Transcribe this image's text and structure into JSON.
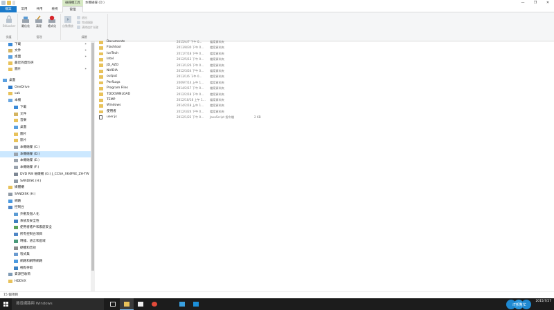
{
  "window": {
    "title": "本機磁碟 (D:)",
    "context_tab_group": "磁碟機工具",
    "controls": [
      "—",
      "❐",
      "✕"
    ]
  },
  "ribbon": {
    "tabs": [
      "檔案",
      "常用",
      "共用",
      "檢視",
      "管理"
    ],
    "groups": [
      {
        "label": "保護",
        "buttons": [
          "BitLocker"
        ]
      },
      {
        "label": "管理",
        "buttons": [
          "最佳化",
          "清理",
          "格式化"
        ]
      },
      {
        "label": "媒體",
        "buttons": [
          "自動播放"
        ],
        "small_cmds": [
          "退出",
          "完成燒錄",
          "清除這片光碟"
        ]
      }
    ]
  },
  "nav": {
    "quick_access": [
      {
        "label": "下載",
        "icon": "download-icon",
        "pinned": true
      },
      {
        "label": "文件",
        "icon": "documents-icon",
        "pinned": true
      },
      {
        "label": "桌面",
        "icon": "desktop-icon",
        "pinned": true
      },
      {
        "label": "最近的資料夾",
        "icon": "recent-folders-icon",
        "pinned": false
      },
      {
        "label": "圖片",
        "icon": "pictures-icon",
        "pinned": true
      }
    ],
    "tree": [
      {
        "label": "桌面",
        "icon": "desktop-icon",
        "level": 0
      },
      {
        "label": "OneDrive",
        "icon": "cloud-icon",
        "level": 1
      },
      {
        "label": "cak",
        "icon": "user-icon",
        "level": 1
      },
      {
        "label": "本機",
        "icon": "computer-icon",
        "level": 1
      },
      {
        "label": "下載",
        "icon": "download-icon",
        "level": 2
      },
      {
        "label": "文件",
        "icon": "documents-icon",
        "level": 2
      },
      {
        "label": "音樂",
        "icon": "music-icon",
        "level": 2
      },
      {
        "label": "桌面",
        "icon": "desktop-icon",
        "level": 2
      },
      {
        "label": "圖片",
        "icon": "pictures-icon",
        "level": 2
      },
      {
        "label": "影片",
        "icon": "videos-icon",
        "level": 2
      },
      {
        "label": "本機磁碟 (C:)",
        "icon": "drive-icon",
        "level": 2
      },
      {
        "label": "本機磁碟 (D:)",
        "icon": "drive-icon",
        "level": 2,
        "selected": true
      },
      {
        "label": "本機磁碟 (E:)",
        "icon": "drive-icon",
        "level": 2
      },
      {
        "label": "本機磁碟 (F:)",
        "icon": "drive-icon",
        "level": 2
      },
      {
        "label": "DVD RW 磁碟機 (G:) J_CCSA_X64FRE_ZH-TW",
        "icon": "dvd-icon",
        "level": 2
      },
      {
        "label": "SANDISK (H:)",
        "icon": "usb-drive-icon",
        "level": 2
      },
      {
        "label": "媒體櫃",
        "icon": "library-icon",
        "level": 1
      },
      {
        "label": "SANDISK (H:)",
        "icon": "usb-drive-icon",
        "level": 1
      },
      {
        "label": "網路",
        "icon": "network-icon",
        "level": 1
      },
      {
        "label": "控制台",
        "icon": "control-panel-icon",
        "level": 1
      },
      {
        "label": "外觀及個人化",
        "icon": "appearance-icon",
        "level": 2
      },
      {
        "label": "系統及安全性",
        "icon": "security-icon",
        "level": 2
      },
      {
        "label": "使用者帳戶和家庭安全",
        "icon": "users-icon",
        "level": 2
      },
      {
        "label": "所有控制台項目",
        "icon": "control-panel-icon",
        "level": 2
      },
      {
        "label": "時鐘、語言和區域",
        "icon": "clock-icon",
        "level": 2
      },
      {
        "label": "硬體和音效",
        "icon": "hardware-icon",
        "level": 2
      },
      {
        "label": "程式集",
        "icon": "programs-icon",
        "level": 2
      },
      {
        "label": "網路和網際網路",
        "icon": "network-icon",
        "level": 2
      },
      {
        "label": "輕鬆存取",
        "icon": "ease-of-access-icon",
        "level": 2
      },
      {
        "label": "資源回收筒",
        "icon": "recycle-bin-icon",
        "level": 1
      },
      {
        "label": "HDDVX",
        "icon": "folder-icon",
        "level": 1
      }
    ]
  },
  "files": [
    {
      "name": "Documents",
      "date": "2015/4/7 下午 0...",
      "type": "檔案資料夾",
      "size": "",
      "icon": "folder-icon"
    },
    {
      "name": "Flashtool",
      "date": "2013/8/30 下午 0...",
      "type": "檔案資料夾",
      "size": "",
      "icon": "folder-icon"
    },
    {
      "name": "IceTech",
      "date": "2011/7/18 下午 0...",
      "type": "檔案資料夾",
      "size": "",
      "icon": "folder-icon"
    },
    {
      "name": "Intel",
      "date": "2012/5/13 下午 0...",
      "type": "檔案資料夾",
      "size": "",
      "icon": "folder-icon"
    },
    {
      "name": "JD_AZO",
      "date": "2013/1/26 下午 0...",
      "type": "檔案資料夾",
      "size": "",
      "icon": "folder-icon"
    },
    {
      "name": "NVIDIA",
      "date": "2012/3/24 下午 0...",
      "type": "檔案資料夾",
      "size": "",
      "icon": "folder-icon"
    },
    {
      "name": "output",
      "date": "2013/1/6 下午 0...",
      "type": "檔案資料夾",
      "size": "",
      "icon": "folder-icon"
    },
    {
      "name": "PerfLogs",
      "date": "2009/7/14 上午 1...",
      "type": "檔案資料夾",
      "size": "",
      "icon": "folder-icon"
    },
    {
      "name": "Program Files",
      "date": "2014/2/17 下午 0...",
      "type": "檔案資料夾",
      "size": "",
      "icon": "folder-icon"
    },
    {
      "name": "TDDOWNLOAD",
      "date": "2012/2/18 下午 0...",
      "type": "檔案資料夾",
      "size": "",
      "icon": "folder-icon"
    },
    {
      "name": "TEMP",
      "date": "2012/10/18 上午 1...",
      "type": "檔案資料夾",
      "size": "",
      "icon": "folder-icon"
    },
    {
      "name": "Windows",
      "date": "2014/2/18 上午 1...",
      "type": "檔案資料夾",
      "size": "",
      "icon": "folder-icon"
    },
    {
      "name": "使用者",
      "date": "2012/3/24 下午 0...",
      "type": "檔案資料夾",
      "size": "",
      "icon": "folder-icon"
    },
    {
      "name": "user.js",
      "date": "2012/1/22 下午 0...",
      "type": "JavaScript 指令檔",
      "size": "2 KB",
      "icon": "js-file-icon"
    }
  ],
  "status": {
    "item_count": "15 個項目"
  },
  "taskbar": {
    "search_placeholder": "搜尋網路與 Windows",
    "apps": [
      "task-view-icon",
      "file-explorer-icon",
      "store-icon",
      "chrome-icon",
      "app-icon",
      "mail-icon"
    ],
    "logo_text": "iT邦幫忙",
    "date": "2015/7/27"
  },
  "colors": {
    "accent": "#1979ca",
    "selection": "#cce8ff",
    "context_tab": "#d7e9c5",
    "folder": "#e8c25b",
    "taskbar": "#1c1c1c"
  }
}
